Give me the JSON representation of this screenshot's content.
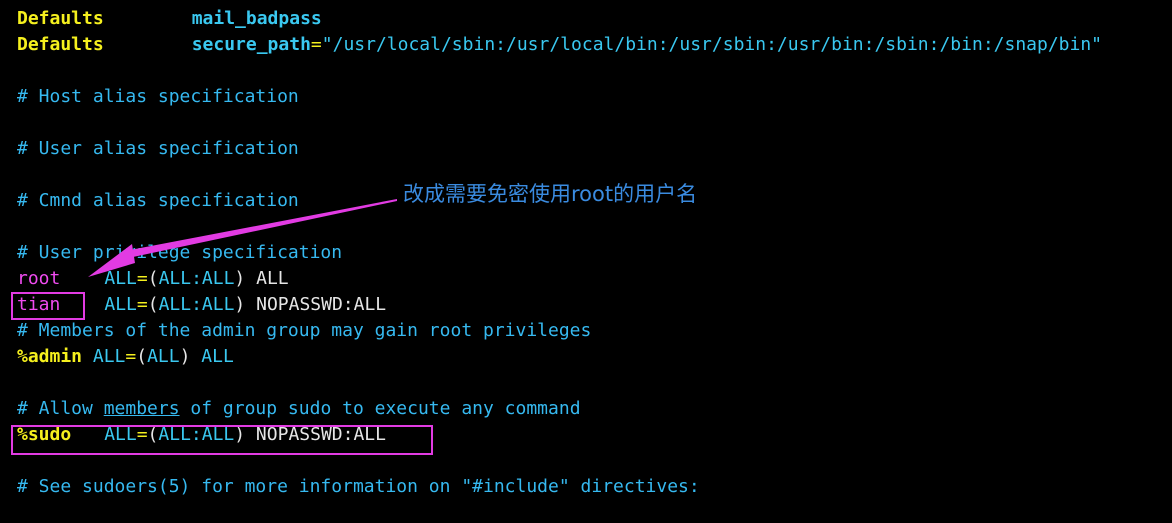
{
  "editor": {
    "lines": {
      "defaults1": {
        "keyword": "Defaults",
        "value": "mail_badpass"
      },
      "defaults2": {
        "keyword": "Defaults",
        "key": "secure_path",
        "eq": "=",
        "value": "\"/usr/local/sbin:/usr/local/bin:/usr/sbin:/usr/bin:/sbin:/bin:/snap/bin\""
      },
      "host_alias": "# Host alias specification",
      "user_alias": "# User alias specification",
      "cmnd_alias": "# Cmnd alias specification",
      "user_priv": "# User privilege specification",
      "root_rule": {
        "user": "root",
        "rule_pre": "ALL",
        "rule_eq": "=",
        "rule_open": "(",
        "rule_hosts": "ALL:ALL",
        "rule_close": ")",
        "rule_post": " ALL"
      },
      "tian_rule": {
        "user": "tian",
        "rule_pre": "ALL",
        "rule_eq": "=",
        "rule_open": "(",
        "rule_hosts": "ALL:ALL",
        "rule_close": ")",
        "rule_post": " NOPASSWD:ALL"
      },
      "members_admin": "# Members of the admin group may gain root privileges",
      "admin_rule": {
        "user": "%admin",
        "rule_pre": " ALL",
        "rule_eq": "=",
        "rule_open": "(",
        "rule_hosts": "ALL",
        "rule_close": ")",
        "rule_post": " ALL"
      },
      "allow_sudo": {
        "pre": "# Allow ",
        "underlined": "members",
        "post": " of group sudo to execute any command"
      },
      "sudo_rule": {
        "user": "%sudo",
        "rule_pre": "ALL",
        "rule_eq": "=",
        "rule_open": "(",
        "rule_hosts": "ALL:ALL",
        "rule_close": ")",
        "rule_post": " NOPASSWD:ALL"
      },
      "see_sudoers": "# See sudoers(5) for more information on \"#include\" directives:"
    }
  },
  "annotation": {
    "text": "改成需要免密使用root的用户名"
  },
  "colors": {
    "background": "#000000",
    "keyword": "#f5f01e",
    "comment": "#36b9f0",
    "user": "#f04bf0",
    "highlight_box": "#e23be3",
    "annotation_text": "#3a8be0"
  }
}
